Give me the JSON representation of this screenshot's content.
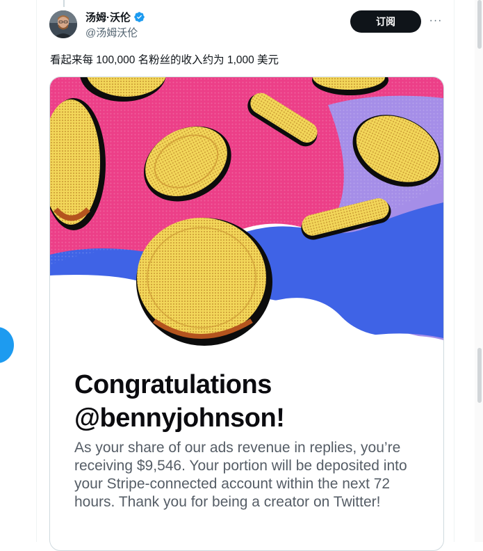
{
  "author": {
    "display_name": "汤姆·沃伦",
    "handle": "@汤姆沃伦",
    "verified": true
  },
  "actions": {
    "subscribe_label": "订阅",
    "more_label": "···"
  },
  "tweet": {
    "text": "看起来每 100,000 名粉丝的收入约为 1,000 美元"
  },
  "media": {
    "headline_line1": "Congratulations",
    "headline_line2": "@bennyjohnson!",
    "body": "As your share of our ads revenue in replies, you’re receiving $9,546. Your portion will be deposited into your Stripe-connected account within the next 72 hours. Thank you for being a creator on Twitter!"
  },
  "colors": {
    "accent": "#1d9bf0",
    "button_bg": "#0f1419",
    "pink": "#ec3f88",
    "blue": "#3f63e6",
    "violet": "#a58ee8",
    "coin": "#f3d75a"
  }
}
